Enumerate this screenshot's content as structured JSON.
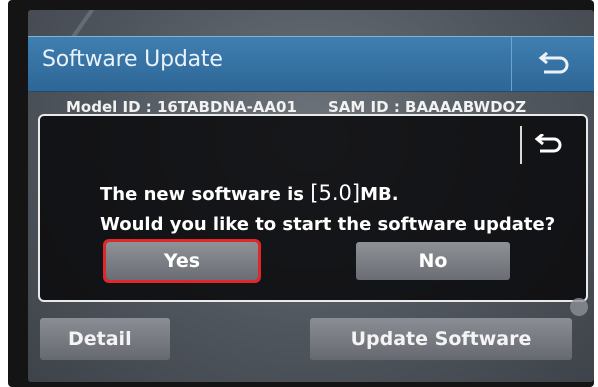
{
  "title": "Software Update",
  "model": {
    "model_id": "Model ID : 16TABDNA-AA01",
    "sam_id": "SAM ID : BAAAABWDOZ"
  },
  "dialog": {
    "message_prefix": "The new software is ",
    "size": "[5.0]",
    "message_suffix": "MB.",
    "question": "Would you like to start the software update?",
    "yes_label": "Yes",
    "no_label": "No"
  },
  "bottom": {
    "detail_label": "Detail",
    "update_label": "Update Software"
  },
  "icons": {
    "back": "back-arrow-icon",
    "scroll": "scroll-down-indicator-icon"
  },
  "colors": {
    "title_bar": "#2d6697",
    "selection_outline": "#e0272b",
    "button": "#7b7f85"
  }
}
